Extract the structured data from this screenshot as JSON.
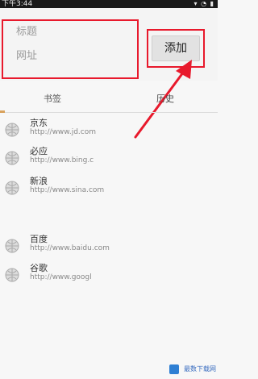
{
  "status_bar": {
    "time": "下午3:44",
    "icons": "▾ ◔ ▮"
  },
  "form": {
    "title_placeholder": "标题",
    "url_placeholder": "网址",
    "add_label": "添加"
  },
  "tabs": {
    "bookmarks": "书签",
    "history": "历史"
  },
  "bookmarks": [
    {
      "name": "京东",
      "url": "http://www.jd.com"
    },
    {
      "name": "必应",
      "url": "http://www.bing.c"
    },
    {
      "name": "新浪",
      "url": "http://www.sina.com"
    },
    {
      "name": "百度",
      "url": "http://www.baidu.com"
    },
    {
      "name": "谷歌",
      "url": "http://www.googl"
    }
  ],
  "watermark": {
    "text": "最数下载网"
  },
  "colors": {
    "annotation_red": "#e8192c",
    "tab_indicator": "#d9a25d"
  }
}
